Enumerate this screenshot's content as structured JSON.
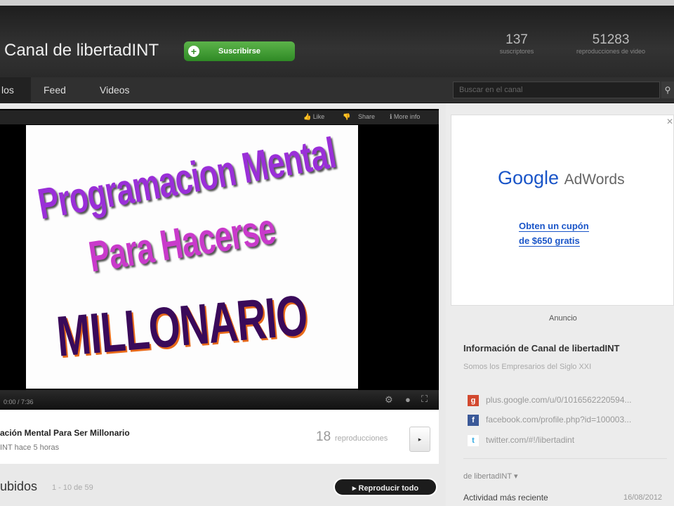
{
  "channel": {
    "title": "Canal de libertadINT",
    "subscribe": "Suscribirse",
    "subscribers": "137",
    "subscribers_label": "suscriptores",
    "views": "51283",
    "views_label": "reproducciones de video"
  },
  "nav": {
    "tabs": [
      "los",
      "Feed",
      "Videos"
    ],
    "search_placeholder": "Buscar en el canal"
  },
  "player": {
    "like": "Like",
    "share": "Share",
    "more_info": "More info",
    "time": "0:00 / 7:36",
    "slide": {
      "line1": "Programacion Mental",
      "line2": "Para Hacerse",
      "line3": "MILLONARIO"
    }
  },
  "video": {
    "title": "ación Mental Para Ser Millonario",
    "meta": "INT hace 5 horas",
    "views_count": "18",
    "views_label": "reproducciones"
  },
  "uploads": {
    "title": "ubidos",
    "range": "1 - 10 de 59",
    "play_all": "Reproducir todo"
  },
  "ad": {
    "google": "Google",
    "adwords": "AdWords",
    "line1": "Obten un cupón",
    "line2": "de $650 gratis",
    "label": "Anuncio"
  },
  "about": {
    "title": "Información de Canal de libertadINT",
    "description": "Somos los Empresarios del Siglo XXI",
    "links": [
      "plus.google.com/u/0/1016562220594...",
      "facebook.com/profile.php?id=100003...",
      "twitter.com/#!/libertadint"
    ],
    "filter": "de libertadINT",
    "activity_label": "Actividad más reciente",
    "activity_date": "16/08/2012"
  },
  "colors": {
    "subscribe": "#3a9a2e",
    "google_blue": "#1a55c8"
  }
}
